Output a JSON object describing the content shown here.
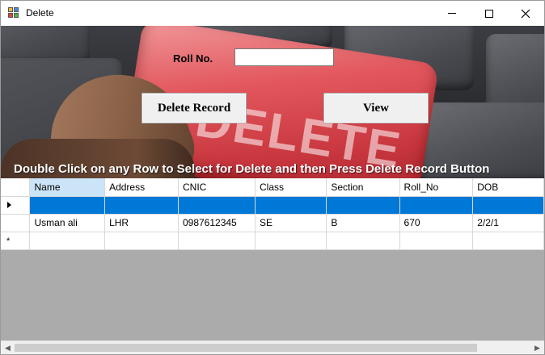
{
  "window": {
    "title": "Delete",
    "minimize_icon": "minimize-icon",
    "maximize_icon": "maximize-icon",
    "close_icon": "close-icon"
  },
  "form": {
    "roll_label": "Roll No.",
    "roll_value": "",
    "delete_button": "Delete Record",
    "view_button": "View",
    "hint": "Double Click on any Row to Select for Delete and then Press Delete Record Button"
  },
  "background_photo": {
    "key_text": "DELETE"
  },
  "grid": {
    "columns": [
      "Name",
      "Address",
      "CNIC",
      "Class",
      "Section",
      "Roll_No",
      "DOB"
    ],
    "selected_column": "Name",
    "rows": [
      {
        "state": "selected",
        "cells": [
          "",
          "",
          "",
          "",
          "",
          "",
          ""
        ]
      },
      {
        "state": "normal",
        "cells": [
          "Usman ali",
          "LHR",
          "0987612345",
          "SE",
          "B",
          "670",
          "2/2/1"
        ]
      },
      {
        "state": "new",
        "cells": [
          "",
          "",
          "",
          "",
          "",
          "",
          ""
        ]
      }
    ]
  },
  "colors": {
    "selection": "#0078d7",
    "selected_header": "#cce4f7",
    "grid_background": "#ababab"
  }
}
